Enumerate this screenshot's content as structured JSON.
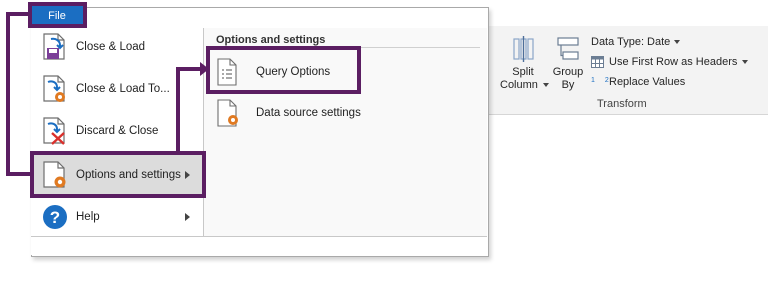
{
  "file_tab": {
    "label": "File"
  },
  "menu": {
    "items": [
      {
        "label": "Close & Load",
        "icon": "close-load-icon"
      },
      {
        "label": "Close & Load To...",
        "icon": "close-load-to-icon"
      },
      {
        "label": "Discard & Close",
        "icon": "discard-close-icon"
      },
      {
        "label": "Options and settings",
        "icon": "options-settings-icon",
        "has_submenu": true,
        "selected": true
      },
      {
        "label": "Help",
        "icon": "help-icon",
        "has_submenu": true
      }
    ]
  },
  "submenu": {
    "heading": "Options and settings",
    "items": [
      {
        "label": "Query Options",
        "icon": "query-options-icon"
      },
      {
        "label": "Data source settings",
        "icon": "data-source-settings-icon"
      }
    ]
  },
  "ribbon": {
    "split_column": {
      "line1": "Split",
      "line2": "Column"
    },
    "group_by": {
      "line1": "Group",
      "line2": "By"
    },
    "data_type": "Data Type: Date",
    "use_first_row": "Use First Row as Headers",
    "replace_values": "Replace Values",
    "replace_values_prefix": "1 2",
    "group_label": "Transform"
  },
  "colors": {
    "annotation": "#5b1e62",
    "file_tab": "#1b6ec2",
    "accent_orange": "#e07a22"
  }
}
